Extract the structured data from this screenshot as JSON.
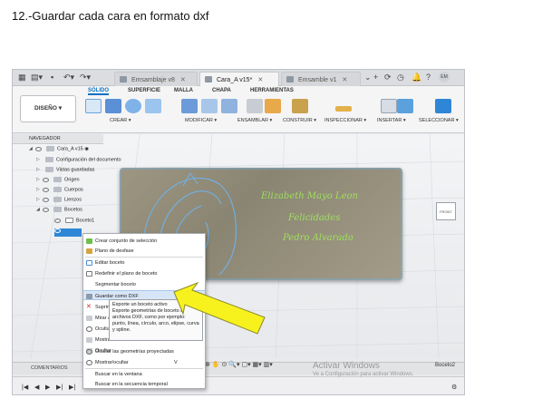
{
  "doc_title": "12.-Guardar cada cara en formato dxf",
  "tabs": [
    {
      "label": "Emsamblaje v8",
      "active": false
    },
    {
      "label": "Cara_A v15*",
      "active": true
    },
    {
      "label": "Emsamble v1",
      "active": false
    }
  ],
  "user_initials": "EM",
  "ribbon": {
    "design_button": "DISEÑO ▾",
    "tabs": [
      "SÓLIDO",
      "SUPERFICIE",
      "MALLA",
      "CHAPA",
      "HERRAMIENTAS"
    ],
    "groups": [
      "CREAR ▾",
      "MODIFICAR ▾",
      "ENSAMBLAR ▾",
      "CONSTRUIR ▾",
      "INSPECCIONAR ▾",
      "INSERTAR ▾",
      "SELECCIONAR ▾"
    ]
  },
  "browser": {
    "title": "NAVEGADOR",
    "root": "Cara_A v15",
    "items": [
      "Configuración del documento",
      "Vistas guardadas",
      "Origen",
      "Cuerpos",
      "Lienzos",
      "Bocetos",
      "Boceto1"
    ]
  },
  "context_menu": {
    "items": [
      "Crear conjunto de selección",
      "Plano de desfase",
      "Editar boceto",
      "Redefinir el plano de boceto",
      "Segmentar boceto",
      "Guardar como DXF",
      "Suprimir",
      "Mirar a",
      "Ocultar",
      "Mostrar",
      "Ocultar",
      "Ocultar las geometrías proyectadas",
      "Mostrar/ocultar",
      "Buscar en la ventana",
      "Buscar en la secuencia temporal"
    ],
    "shortcut_show_hide": "V"
  },
  "tooltip": {
    "title": "Exporte un boceto activo",
    "body": "Exporte geometrías de boceto a archivos DXF, como por ejemplo: punto, línea, círculo, arco, elipse, curva y spline."
  },
  "bottom": {
    "comments": "COMENTARIOS",
    "activate_title": "Activar Windows",
    "activate_sub": "Ve a Configuración para activar Windows.",
    "active_sketch": "Boceto2"
  },
  "colors": {
    "accent": "#0b6fc2",
    "arrow": "#f7f21e",
    "script_text": "#9fe05e"
  }
}
